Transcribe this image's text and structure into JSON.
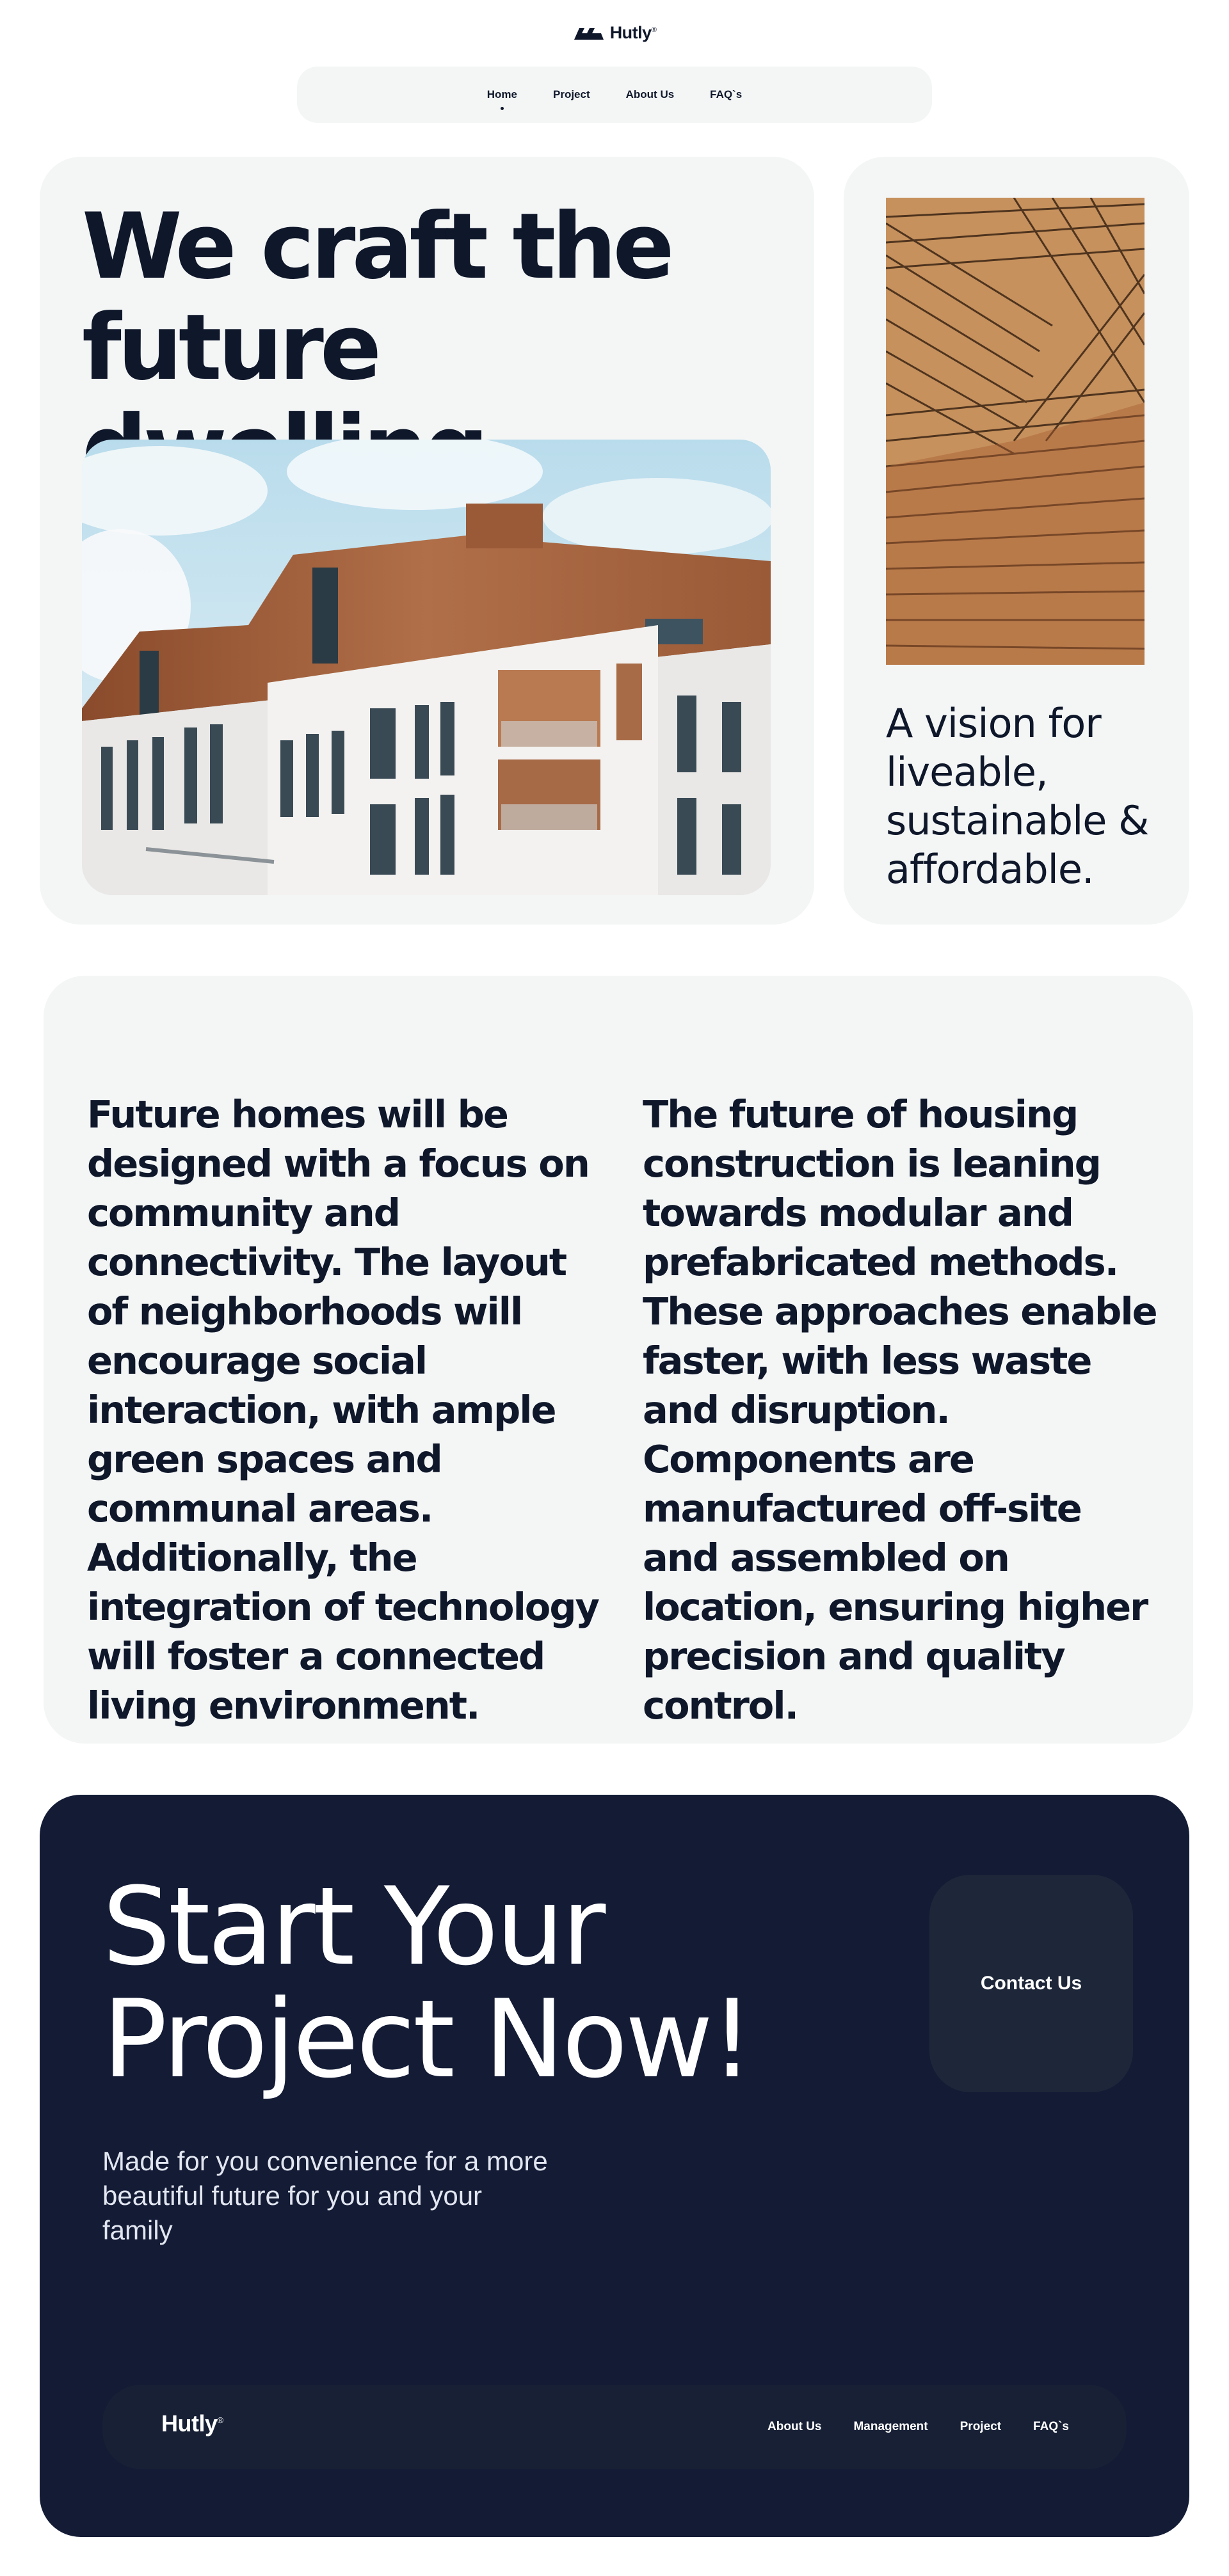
{
  "brand": {
    "name": "Hutly",
    "mark": "®"
  },
  "nav": {
    "items": [
      {
        "label": "Home"
      },
      {
        "label": "Project"
      },
      {
        "label": "About Us"
      },
      {
        "label": "FAQ`s"
      }
    ],
    "active": "Home"
  },
  "hero": {
    "title_line1": "We craft the",
    "title_line2": "future dwelling.",
    "side_text": "A vision for liveable, sustainable & affordable."
  },
  "info": {
    "left": "Future homes will be designed with a focus on community and connectivity. The layout of neighborhoods will encourage social interaction, with ample green spaces and communal areas. Additionally, the integration of technology will foster a connected living environment.",
    "right": "The future of housing construction is leaning towards modular and prefabricated methods. These approaches enable faster, with less waste and disruption. Components are manufactured off-site and assembled on location, ensuring higher precision and quality control."
  },
  "cta": {
    "title_line1": "Start Your",
    "title_line2": "Project Now!",
    "subtitle": "Made for you convenience for a more beautiful future for you and your family",
    "button": "Contact Us"
  },
  "footer": {
    "brand": "Hutly",
    "mark": "®",
    "links": [
      {
        "label": "About Us"
      },
      {
        "label": "Management"
      },
      {
        "label": "Project"
      },
      {
        "label": "FAQ`s"
      }
    ]
  },
  "colors": {
    "navy": "#131b35",
    "card": "#f4f6f6",
    "text": "#0f172a"
  },
  "icons": {
    "logo": "hutly-wave-logo-icon"
  }
}
